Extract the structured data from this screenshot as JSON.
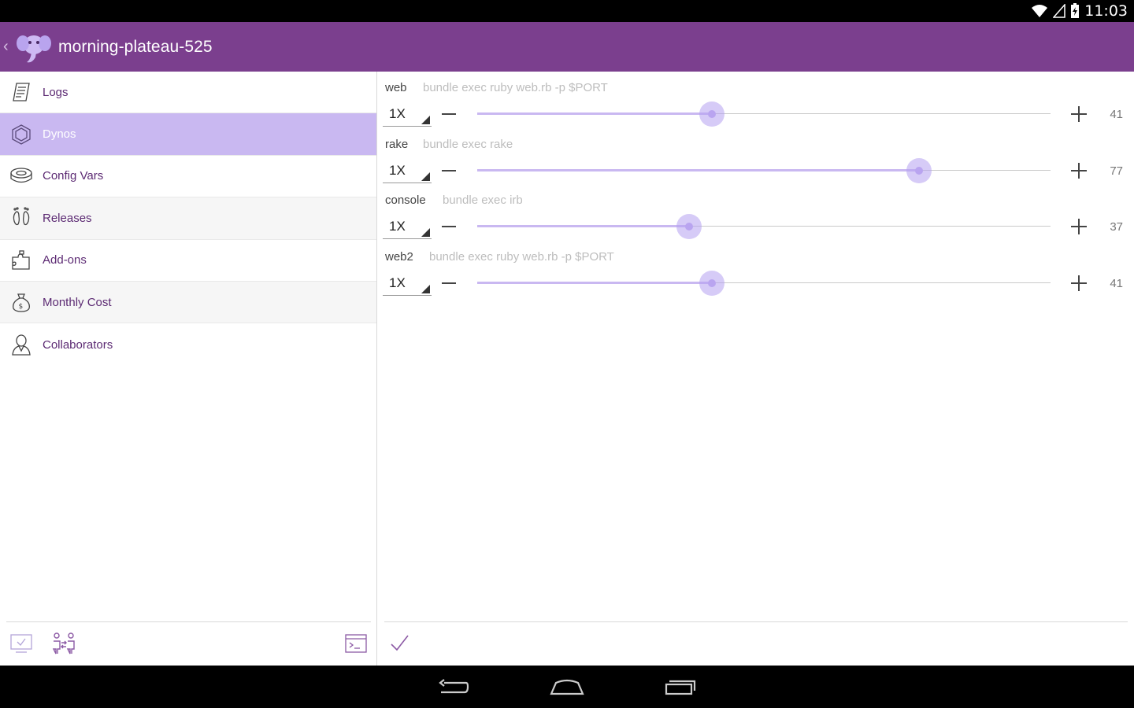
{
  "status_bar": {
    "time": "11:03",
    "icons": [
      "wifi-icon",
      "signal-icon",
      "battery-charging-icon"
    ]
  },
  "action_bar": {
    "app_name": "morning-plateau-525",
    "logo_icon": "elephant-logo-icon",
    "up_icon": "back-chevron-icon"
  },
  "sidebar": {
    "items": [
      {
        "label": "Logs",
        "icon": "logs-icon"
      },
      {
        "label": "Dynos",
        "icon": "hexagon-icon",
        "active": true
      },
      {
        "label": "Config Vars",
        "icon": "config-vars-icon"
      },
      {
        "label": "Releases",
        "icon": "footprints-icon"
      },
      {
        "label": "Add-ons",
        "icon": "puzzle-icon"
      },
      {
        "label": "Monthly Cost",
        "icon": "money-bag-icon"
      },
      {
        "label": "Collaborators",
        "icon": "person-icon"
      }
    ],
    "footer_icons": [
      "monitor-check-icon",
      "people-transfer-icon",
      "terminal-icon"
    ]
  },
  "dynos": [
    {
      "name": "web",
      "command": "bundle exec ruby web.rb -p $PORT",
      "size": "1X",
      "count": "41",
      "level": 0.41
    },
    {
      "name": "rake",
      "command": "bundle exec rake",
      "size": "1X",
      "count": "77",
      "level": 0.77
    },
    {
      "name": "console",
      "command": "bundle exec irb",
      "size": "1X",
      "count": "37",
      "level": 0.37
    },
    {
      "name": "web2",
      "command": "bundle exec ruby web.rb -p $PORT",
      "size": "1X",
      "count": "41",
      "level": 0.41
    }
  ],
  "main_footer": {
    "confirm_icon": "checkmark-icon"
  },
  "nav_bar": {
    "icons": [
      "back-icon",
      "home-icon",
      "recents-icon"
    ]
  },
  "colors": {
    "action_bar": "#7b3f8e",
    "active_item": "#c9b8f1",
    "nav_label": "#5c2a73",
    "slider_fill": "#c9b8f1"
  }
}
